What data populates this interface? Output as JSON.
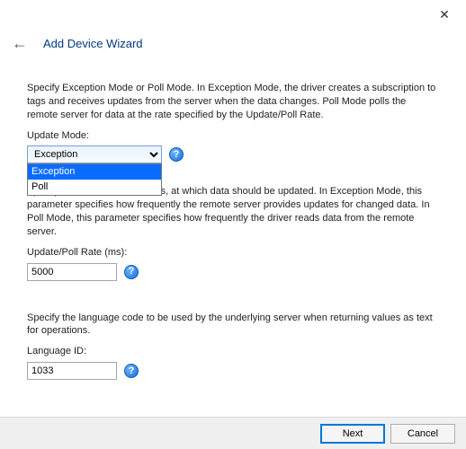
{
  "window": {
    "title": "Add Device Wizard"
  },
  "section_mode": {
    "description": "Specify Exception Mode or Poll Mode. In Exception Mode, the driver creates a subscription to tags and receives updates from the server when the data changes. Poll Mode polls the remote server for data at the rate specified by the Update/Poll Rate.",
    "label": "Update Mode:",
    "selected": "Exception",
    "options": [
      "Exception",
      "Poll"
    ]
  },
  "section_rate": {
    "description": "Specify the rate, in milliseconds, at which data should be updated. In Exception Mode, this parameter specifies how frequently the remote server provides updates for changed data. In Poll Mode, this parameter specifies how frequently the driver reads data from the remote server.",
    "label": "Update/Poll Rate (ms):",
    "value": "5000"
  },
  "section_lang": {
    "description": "Specify the language code to be used by the underlying server when returning values as text for operations.",
    "label": "Language ID:",
    "value": "1033"
  },
  "footer": {
    "next": "Next",
    "cancel": "Cancel"
  },
  "icons": {
    "help": "?",
    "close": "✕",
    "back": "←"
  }
}
